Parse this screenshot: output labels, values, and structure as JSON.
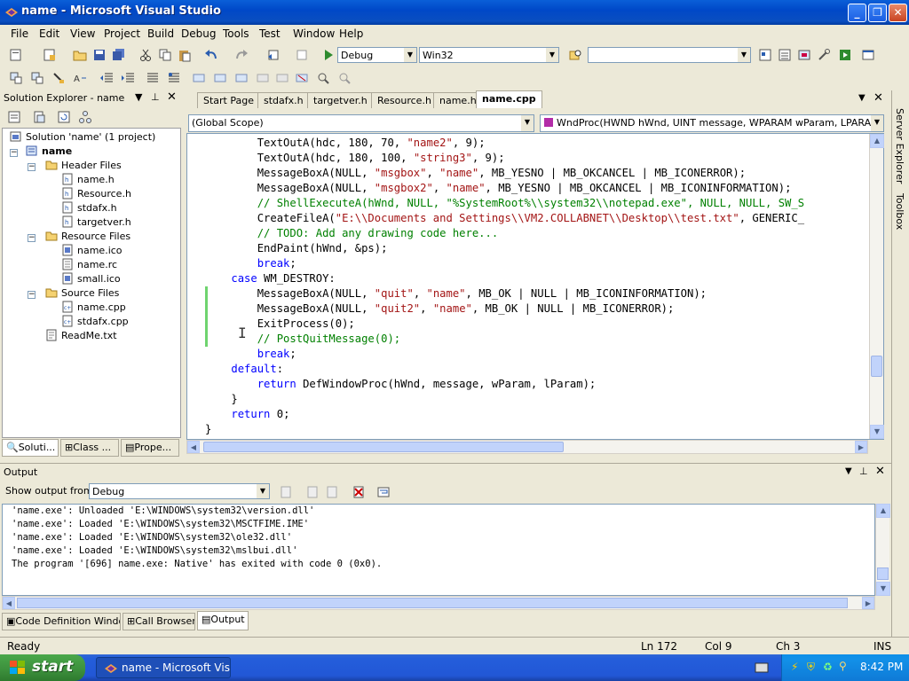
{
  "window": {
    "title": "name - Microsoft Visual Studio"
  },
  "menu": [
    "File",
    "Edit",
    "View",
    "Project",
    "Build",
    "Debug",
    "Tools",
    "Test",
    "Window",
    "Help"
  ],
  "toolbar": {
    "config": "Debug",
    "platform": "Win32",
    "find": ""
  },
  "solution_explorer": {
    "title": "Solution Explorer - name",
    "solution": "Solution 'name' (1 project)",
    "project": "name",
    "folders": [
      {
        "label": "Header Files",
        "items": [
          "name.h",
          "Resource.h",
          "stdafx.h",
          "targetver.h"
        ]
      },
      {
        "label": "Resource Files",
        "items": [
          "name.ico",
          "name.rc",
          "small.ico"
        ]
      },
      {
        "label": "Source Files",
        "items": [
          "name.cpp",
          "stdafx.cpp"
        ]
      }
    ],
    "readme": "ReadMe.txt",
    "bottom_tabs": [
      "Soluti...",
      "Class ...",
      "Prope..."
    ]
  },
  "side_tabs": [
    "Server Explorer",
    "Toolbox"
  ],
  "doc_tabs": [
    "Start Page",
    "stdafx.h",
    "targetver.h",
    "Resource.h",
    "name.h",
    "name.cpp"
  ],
  "scope": {
    "left": "(Global Scope)",
    "right": "WndProc(HWND hWnd, UINT message, WPARAM wParam, LPARAM lPara"
  },
  "code": [
    [
      {
        "t": "        TextOutA(hdc, 180, 70, "
      },
      {
        "s": "str",
        "t": "\"name2\""
      },
      {
        "t": ", 9);"
      }
    ],
    [
      {
        "t": "        TextOutA(hdc, 180, 100, "
      },
      {
        "s": "str",
        "t": "\"string3\""
      },
      {
        "t": ", 9);"
      }
    ],
    [
      {
        "t": "        MessageBoxA(NULL, "
      },
      {
        "s": "str",
        "t": "\"msgbox\""
      },
      {
        "t": ", "
      },
      {
        "s": "str",
        "t": "\"name\""
      },
      {
        "t": ", MB_YESNO | MB_OKCANCEL | MB_ICONERROR);"
      }
    ],
    [
      {
        "t": "        MessageBoxA(NULL, "
      },
      {
        "s": "str",
        "t": "\"msgbox2\""
      },
      {
        "t": ", "
      },
      {
        "s": "str",
        "t": "\"name\""
      },
      {
        "t": ", MB_YESNO | MB_OKCANCEL | MB_ICONINFORMATION);"
      }
    ],
    [
      {
        "s": "cm",
        "t": "        // ShellExecuteA(hWnd, NULL, \"%SystemRoot%\\\\system32\\\\notepad.exe\", NULL, NULL, SW_S"
      }
    ],
    [
      {
        "t": "        CreateFileA("
      },
      {
        "s": "str",
        "t": "\"E:\\\\Documents and Settings\\\\VM2.COLLABNET\\\\Desktop\\\\test.txt\""
      },
      {
        "t": ", GENERIC_"
      }
    ],
    [
      {
        "s": "cm",
        "t": "        // TODO: Add any drawing code here..."
      }
    ],
    [
      {
        "t": "        EndPaint(hWnd, &ps);"
      }
    ],
    [
      {
        "t": "        "
      },
      {
        "s": "kw",
        "t": "break"
      },
      {
        "t": ";"
      }
    ],
    [
      {
        "t": "    "
      },
      {
        "s": "kw",
        "t": "case"
      },
      {
        "t": " WM_DESTROY:"
      }
    ],
    [
      {
        "t": "        MessageBoxA(NULL, "
      },
      {
        "s": "str",
        "t": "\"quit\""
      },
      {
        "t": ", "
      },
      {
        "s": "str",
        "t": "\"name\""
      },
      {
        "t": ", MB_OK | NULL | MB_ICONINFORMATION);"
      }
    ],
    [
      {
        "t": "        MessageBoxA(NULL, "
      },
      {
        "s": "str",
        "t": "\"quit2\""
      },
      {
        "t": ", "
      },
      {
        "s": "str",
        "t": "\"name\""
      },
      {
        "t": ", MB_OK | NULL | MB_ICONERROR);"
      }
    ],
    [
      {
        "t": "        ExitProcess(0);"
      }
    ],
    [
      {
        "s": "cm",
        "t": "        // PostQuitMessage(0);"
      }
    ],
    [
      {
        "t": "        "
      },
      {
        "s": "kw",
        "t": "break"
      },
      {
        "t": ";"
      }
    ],
    [
      {
        "t": "    "
      },
      {
        "s": "kw",
        "t": "default"
      },
      {
        "t": ":"
      }
    ],
    [
      {
        "t": "        "
      },
      {
        "s": "kw",
        "t": "return"
      },
      {
        "t": " DefWindowProc(hWnd, message, wParam, lParam);"
      }
    ],
    [
      {
        "t": "    }"
      }
    ],
    [
      {
        "t": "    "
      },
      {
        "s": "kw",
        "t": "return"
      },
      {
        "t": " 0;"
      }
    ],
    [
      {
        "t": "}"
      }
    ]
  ],
  "output": {
    "title": "Output",
    "show_from_label": "Show output from:",
    "source": "Debug",
    "lines": [
      "'name.exe': Unloaded 'E:\\WINDOWS\\system32\\version.dll'",
      "'name.exe': Loaded 'E:\\WINDOWS\\system32\\MSCTFIME.IME'",
      "'name.exe': Loaded 'E:\\WINDOWS\\system32\\ole32.dll'",
      "'name.exe': Loaded 'E:\\WINDOWS\\system32\\mslbui.dll'",
      "The program '[696] name.exe: Native' has exited with code 0 (0x0)."
    ],
    "bottom_tabs": [
      "Code Definition Window",
      "Call Browser",
      "Output"
    ]
  },
  "status": {
    "ready": "Ready",
    "ln": "Ln 172",
    "col": "Col 9",
    "ch": "Ch 3",
    "ins": "INS"
  },
  "taskbar": {
    "start": "start",
    "item": "name - Microsoft Visu...",
    "time": "8:42 PM"
  },
  "colors": {
    "string": "#a31515",
    "keyword": "#0000ff",
    "comment": "#008000",
    "title_bar": "#0a5fd8"
  }
}
